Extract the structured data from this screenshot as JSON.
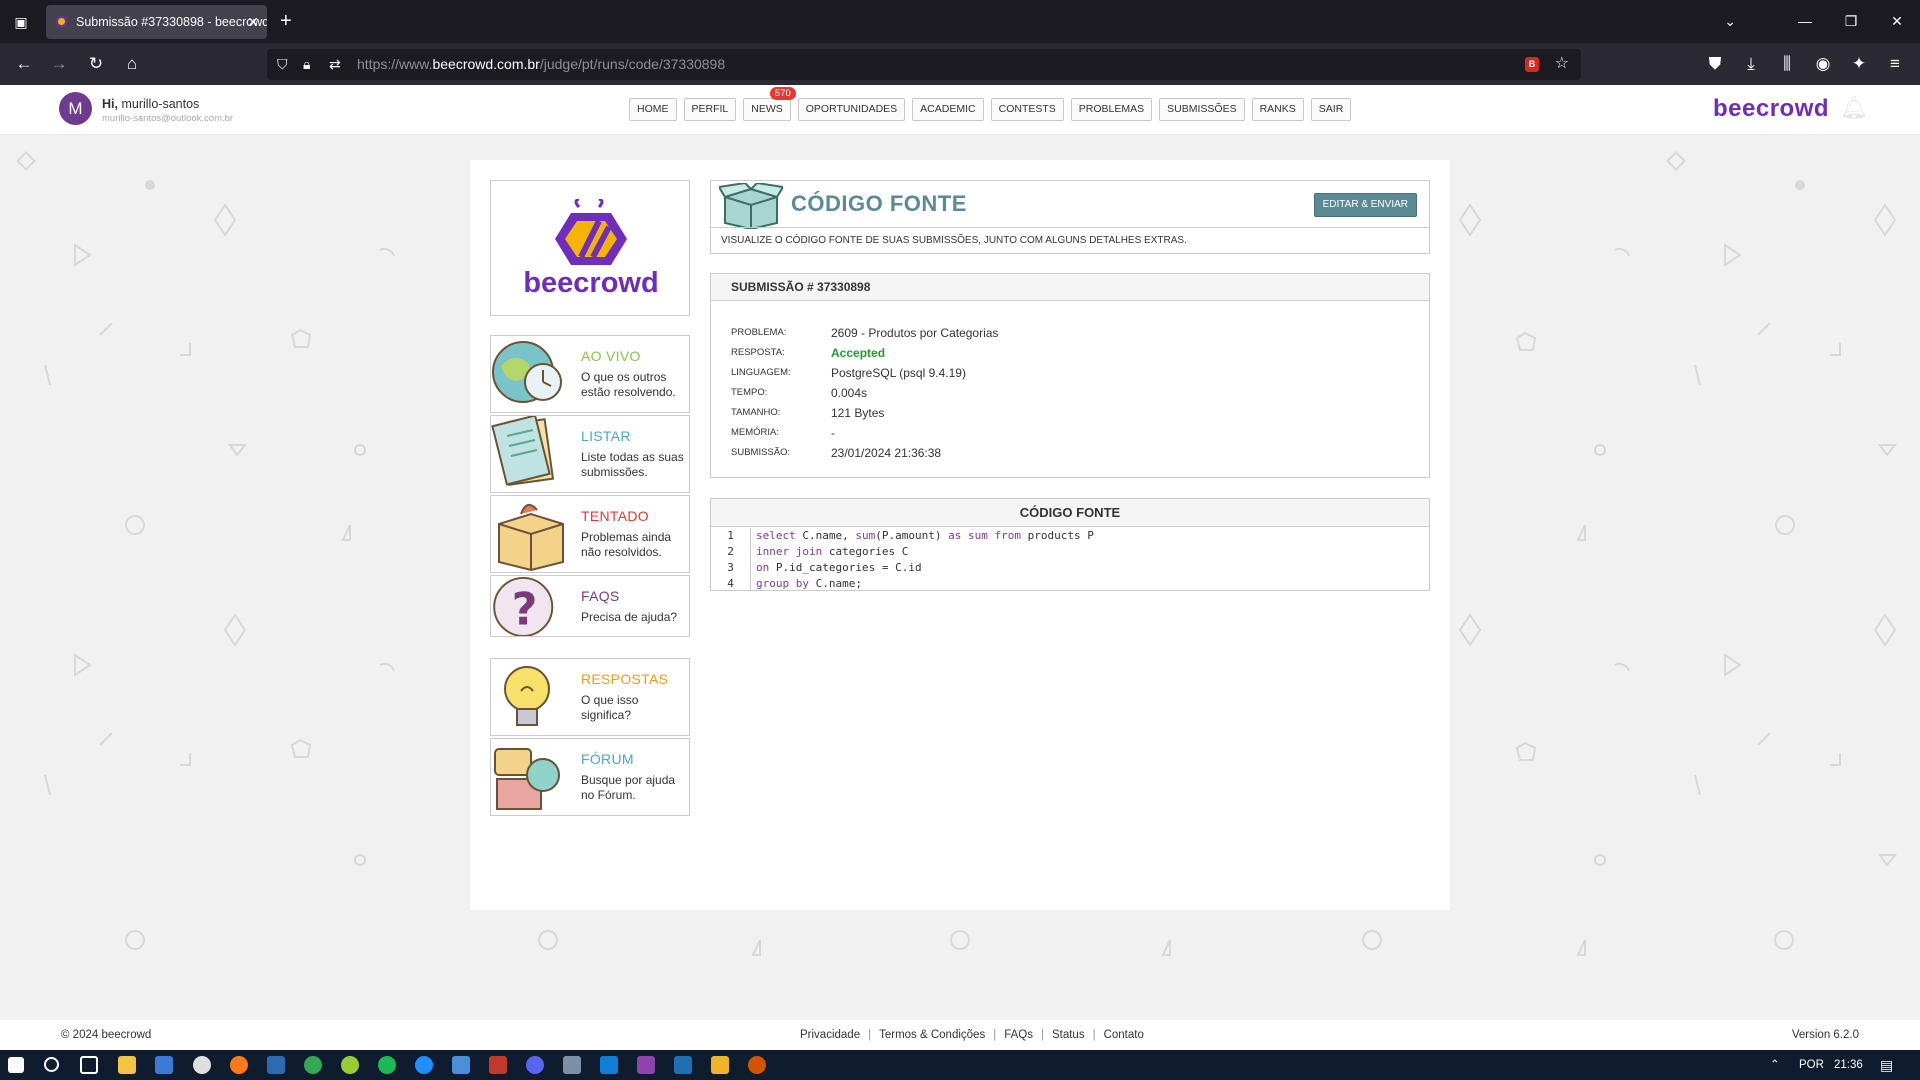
{
  "browser": {
    "tab_title": "Submissão #37330898 - beecrowd",
    "url_prefix": "https://www.",
    "url_domain": "beecrowd.com.br",
    "url_path": "/judge/pt/runs/code/37330898"
  },
  "header": {
    "avatar_letter": "M",
    "greeting": "Hi,",
    "username": "murillo-santos",
    "email": "murillo-santos@outlook.com.br",
    "brand": "beecrowd",
    "menu": [
      {
        "label": "HOME"
      },
      {
        "label": "PERFIL"
      },
      {
        "label": "NEWS",
        "badge": "570"
      },
      {
        "label": "OPORTUNIDADES"
      },
      {
        "label": "ACADEMIC"
      },
      {
        "label": "CONTESTS"
      },
      {
        "label": "PROBLEMAS"
      },
      {
        "label": "SUBMISSÕES"
      },
      {
        "label": "RANKS"
      },
      {
        "label": "SAIR"
      }
    ]
  },
  "logo_text": "beecrowd",
  "sidebar": [
    {
      "title": "AO VIVO",
      "desc": "O que os outros estão resolvendo.",
      "color": "#8bc34a",
      "icon": "globe-clock-icon"
    },
    {
      "title": "LISTAR",
      "desc": "Liste todas as suas submissões.",
      "color": "#4aa8c2",
      "icon": "list-paper-icon"
    },
    {
      "title": "TENTADO",
      "desc": "Problemas ainda não resolvidos.",
      "color": "#e53935",
      "icon": "box-icon"
    },
    {
      "title": "FAQS",
      "desc": "Precisa de ajuda?",
      "color": "#7a3b78",
      "icon": "question-icon"
    },
    {
      "title": "RESPOSTAS",
      "desc": "O que isso significa?",
      "color": "#f39c12",
      "icon": "lightbulb-icon"
    },
    {
      "title": "FÓRUM",
      "desc": "Busque por ajuda no Fórum.",
      "color": "#4aa8c2",
      "icon": "chat-bubbles-icon"
    }
  ],
  "code_header": {
    "title": "CÓDIGO FONTE",
    "button": "EDITAR & ENVIAR",
    "subtitle": "VISUALIZE O CÓDIGO FONTE DE SUAS SUBMISSÕES, JUNTO COM ALGUNS DETALHES EXTRAS."
  },
  "submission": {
    "heading": "SUBMISSÃO # 37330898",
    "fields": [
      {
        "label": "PROBLEMA:",
        "value": "2609 - Produtos por Categorias"
      },
      {
        "label": "RESPOSTA:",
        "value": "Accepted"
      },
      {
        "label": "LINGUAGEM:",
        "value": "PostgreSQL (psql 9.4.19)"
      },
      {
        "label": "TEMPO:",
        "value": "0.004s"
      },
      {
        "label": "TAMANHO:",
        "value": "121 Bytes"
      },
      {
        "label": "MEMÓRIA:",
        "value": "-"
      },
      {
        "label": "SUBMISSÃO:",
        "value": "23/01/2024 21:36:38"
      }
    ]
  },
  "source": {
    "heading": "CÓDIGO FONTE",
    "lines": [
      {
        "n": "1",
        "code": "select C.name, sum(P.amount) as sum from products P"
      },
      {
        "n": "2",
        "code": "inner join categories C"
      },
      {
        "n": "3",
        "code": "on P.id_categories = C.id"
      },
      {
        "n": "4",
        "code": "group by C.name;"
      }
    ]
  },
  "footer": {
    "copyright": "© 2024 beecrowd",
    "links": [
      "Privacidade",
      "Termos & Condições",
      "FAQs",
      "Status",
      "Contato"
    ],
    "version": "Version 6.2.0"
  },
  "taskbar": {
    "lang": "POR",
    "time": "21:36"
  }
}
